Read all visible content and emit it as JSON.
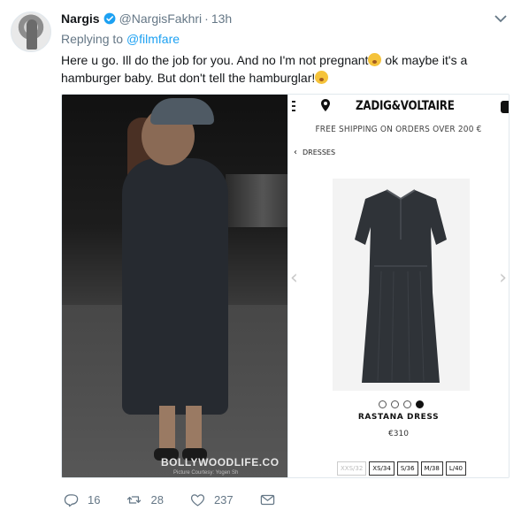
{
  "tweet": {
    "author_name": "Nargis",
    "author_handle": "@NargisFakhri",
    "separator": "·",
    "timestamp": "13h",
    "replying_prefix": "Replying to ",
    "replying_to": "@filmfare",
    "text_line1": "Here u go. Ill do the job for you. And no I'm not pregnant",
    "text_line1_tail": " ok maybe it's a",
    "text_line2": "hamburger baby. But don't tell the hamburglar!",
    "emojis": [
      "flushed-face-emoji",
      "tears-of-joy-emoji"
    ]
  },
  "photo": {
    "watermark": "BOLLYWOODLIFE.CO",
    "credit": "Picture Courtesy: Yogen Sh"
  },
  "shop": {
    "brand": "ZADIG&VOLTAIRE",
    "shipping_banner": "FREE SHIPPING ON ORDERS OVER 200 €",
    "breadcrumb": "DRESSES",
    "carousel_total": 4,
    "carousel_active": 4,
    "product_name": "RASTANA DRESS",
    "product_price": "€310",
    "sizes": [
      {
        "label": "XXS/32",
        "available": false
      },
      {
        "label": "XS/34",
        "available": true
      },
      {
        "label": "S/36",
        "available": true
      },
      {
        "label": "M/38",
        "available": true
      },
      {
        "label": "L/40",
        "available": true
      }
    ],
    "icons": [
      "menu-icon",
      "location-pin-icon",
      "shopping-bag-icon",
      "chevron-left-icon"
    ]
  },
  "actions": {
    "replies": "16",
    "retweets": "28",
    "likes": "237",
    "icons": [
      "reply-icon",
      "retweet-icon",
      "like-icon",
      "direct-message-icon"
    ]
  },
  "colors": {
    "link": "#1da1f2",
    "secondary_text": "#657786",
    "verified": "#1da1f2"
  }
}
